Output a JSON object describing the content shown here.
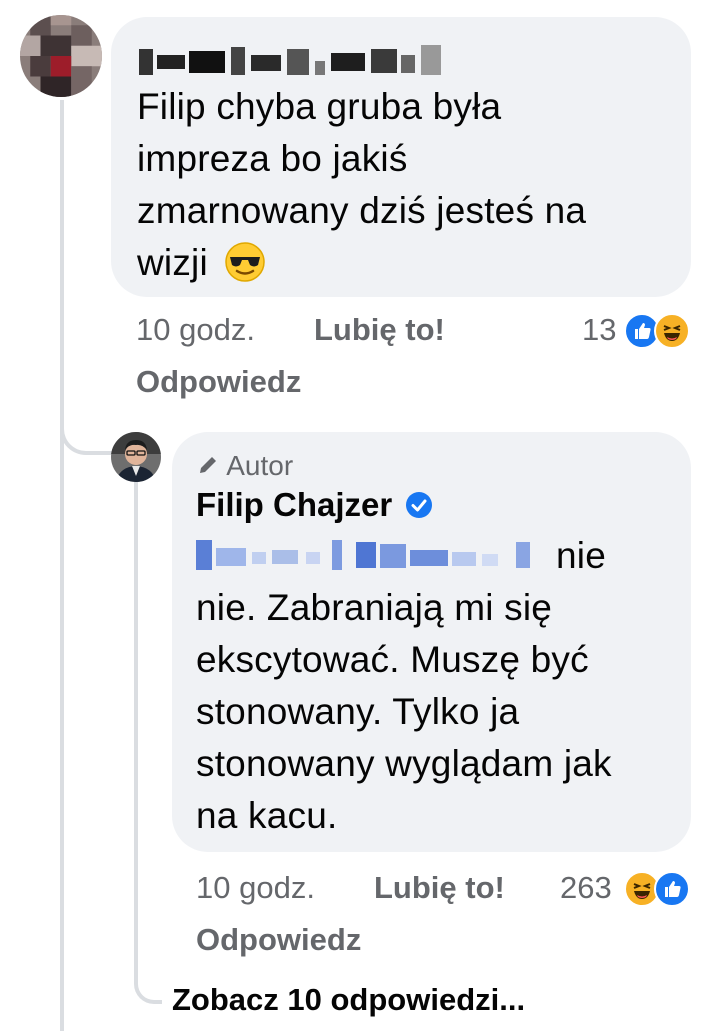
{
  "comment1": {
    "text": "Filip chyba gruba była impreza bo jakiś zmarnowany dziś jesteś na wizji",
    "lines": [
      "Filip chyba gruba była",
      "impreza bo jakiś",
      "zmarnowany dziś jesteś na",
      "wizji"
    ],
    "emoji_icon": "sunglasses-emoji-icon",
    "time": "10 godz.",
    "like_label": "Lubię to!",
    "reply_label": "Odpowiedz",
    "reaction_count": "13",
    "reactions": [
      "like-icon",
      "haha-icon"
    ]
  },
  "reply": {
    "author_badge": "Autor",
    "author_name": "Filip Chajzer",
    "verified_icon": "verified-badge-icon",
    "lines_after_mention": [
      "nie",
      "nie. Zabraniają mi się",
      "ekscytować. Muszę być",
      "stonowany. Tylko ja",
      "stonowany wyglądam jak",
      "na kacu."
    ],
    "time": "10 godz.",
    "like_label": "Lubię to!",
    "reply_label": "Odpowiedz",
    "reaction_count": "263",
    "reactions": [
      "haha-icon",
      "like-icon"
    ]
  },
  "more_replies": "Zobacz 10 odpowiedzi...",
  "colors": {
    "bubble": "#f0f2f5",
    "meta_text": "#65676b",
    "like_blue": "#1877f2",
    "haha_yellow": "#f7b125",
    "thread_line": "#dadde1"
  }
}
